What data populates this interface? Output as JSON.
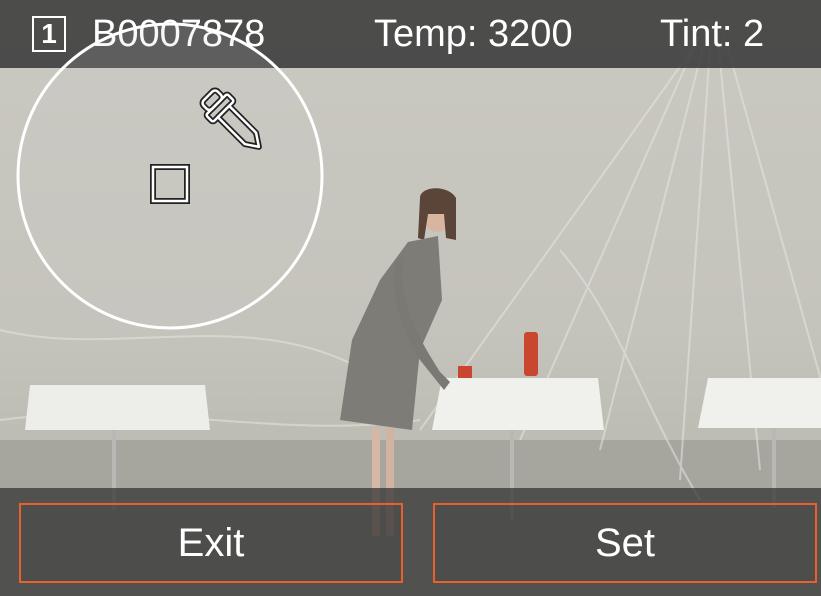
{
  "header": {
    "frame_number": "1",
    "file_name": "B0007878",
    "temperature": "Temp: 3200",
    "tint": "Tint: 2"
  },
  "picker": {
    "icon": "eyedropper-icon",
    "target_icon": "square-target-icon"
  },
  "actions": {
    "exit_label": "Exit",
    "set_label": "Set"
  },
  "colors": {
    "accent": "#e8612c",
    "bar": "#3a3a3a",
    "text": "#ffffff"
  }
}
